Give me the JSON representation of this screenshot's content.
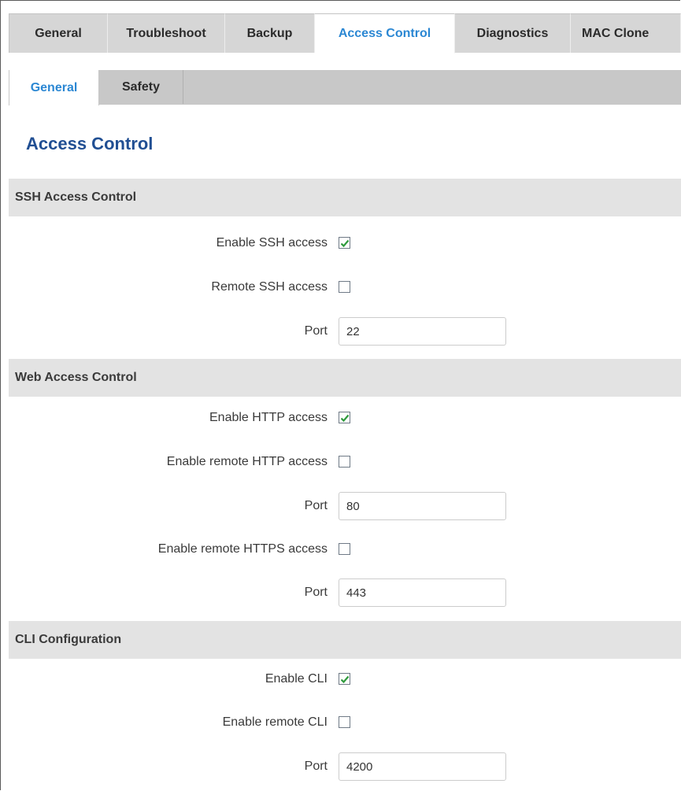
{
  "top_tabs": [
    "General",
    "Troubleshoot",
    "Backup",
    "Access Control",
    "Diagnostics",
    "MAC Clone"
  ],
  "top_tabs_active": "Access Control",
  "sub_tabs": [
    "General",
    "Safety"
  ],
  "sub_tabs_active": "General",
  "page_title": "Access Control",
  "sections": {
    "ssh": {
      "title": "SSH Access Control",
      "enable_ssh_label": "Enable SSH access",
      "enable_ssh_checked": true,
      "remote_ssh_label": "Remote SSH access",
      "remote_ssh_checked": false,
      "port_label": "Port",
      "port_value": "22"
    },
    "web": {
      "title": "Web Access Control",
      "enable_http_label": "Enable HTTP access",
      "enable_http_checked": true,
      "remote_http_label": "Enable remote HTTP access",
      "remote_http_checked": false,
      "http_port_label": "Port",
      "http_port_value": "80",
      "remote_https_label": "Enable remote HTTPS access",
      "remote_https_checked": false,
      "https_port_label": "Port",
      "https_port_value": "443"
    },
    "cli": {
      "title": "CLI Configuration",
      "enable_cli_label": "Enable CLI",
      "enable_cli_checked": true,
      "remote_cli_label": "Enable remote CLI",
      "remote_cli_checked": false,
      "port_label": "Port",
      "port_value": "4200"
    }
  },
  "colors": {
    "accent": "#2b87d3",
    "title": "#214f93",
    "check": "#2e9a3c"
  }
}
